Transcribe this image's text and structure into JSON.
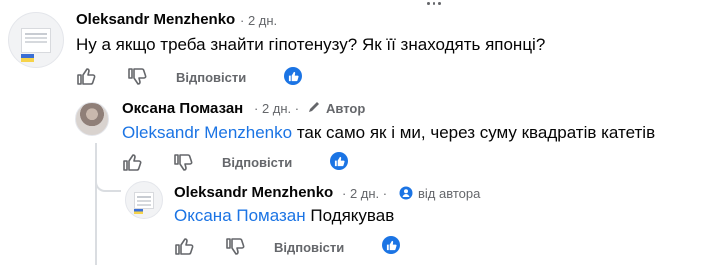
{
  "comments": [
    {
      "author": "Oleksandr Menzhenko",
      "time": "· 2 дн.",
      "text": "Ну а якщо треба знайти гіпотенузу? Як її знаходять японці?",
      "reply_label": "Відповісти"
    },
    {
      "author": "Оксана Помазан",
      "time": "· 2 дн. ·",
      "badge": "Автор",
      "mention": "Oleksandr Menzhenko",
      "text": " так само як і ми, через суму квадратів катетів",
      "reply_label": "Відповісти"
    },
    {
      "author": "Oleksandr Menzhenko",
      "time": "· 2 дн. ·",
      "badge": "від автора",
      "mention": "Оксана Помазан",
      "text": " Подякував",
      "reply_label": "Відповісти"
    }
  ],
  "colors": {
    "accent": "#1b74e4",
    "muted": "#65676b",
    "thread": "#dadde1"
  }
}
